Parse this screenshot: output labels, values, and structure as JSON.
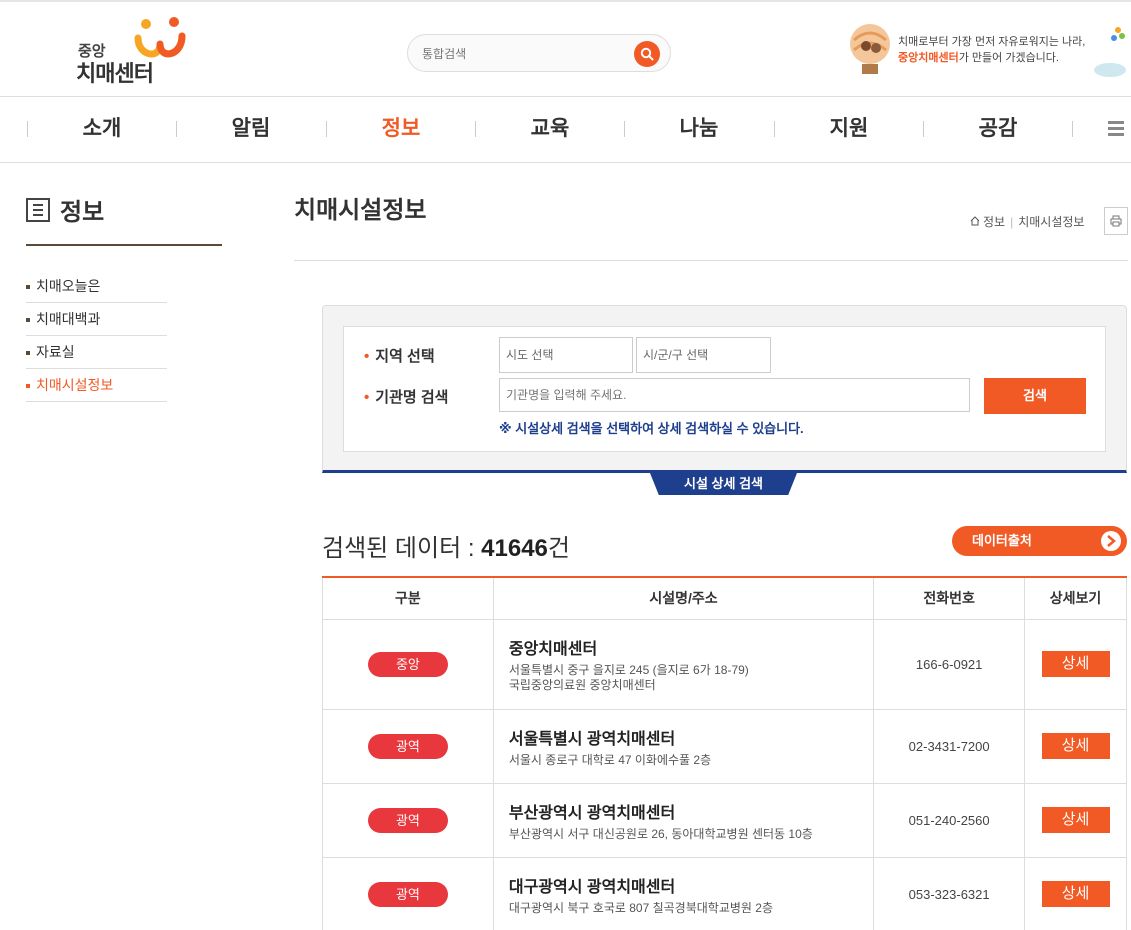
{
  "header": {
    "logo_small": "중앙",
    "logo_big": "치매센터",
    "search_placeholder": "통합검색",
    "slogan_line1": "치매로부터 가장 먼저 자유로워지는 나라,",
    "slogan_org": "중앙치매센터",
    "slogan_line2_rest": "가 만들어 가겠습니다."
  },
  "gnb": {
    "items": [
      {
        "label": "소개"
      },
      {
        "label": "알림"
      },
      {
        "label": "정보"
      },
      {
        "label": "교육"
      },
      {
        "label": "나눔"
      },
      {
        "label": "지원"
      },
      {
        "label": "공감"
      }
    ],
    "active_index": 2
  },
  "side": {
    "title": "정보",
    "items": [
      {
        "label": "치매오늘은"
      },
      {
        "label": "치매대백과"
      },
      {
        "label": "자료실"
      },
      {
        "label": "치매시설정보"
      }
    ],
    "active_index": 3
  },
  "page": {
    "title": "치매시설정보",
    "breadcrumb": [
      "정보",
      "치매시설정보"
    ]
  },
  "search": {
    "region_label": "지역 선택",
    "sido_placeholder": "시도 선택",
    "sigungu_placeholder": "시/군/구 선택",
    "name_label": "기관명 검색",
    "name_placeholder": "기관명을 입력해 주세요.",
    "submit_label": "검색",
    "hint": "※ 시설상세 검색을 선택하여 상세 검색하실 수 있습니다.",
    "detail_tab": "시설 상세 검색"
  },
  "result": {
    "prefix": "검색된 데이터 : ",
    "count": "41646",
    "suffix": "건",
    "export_label": "데이터출처"
  },
  "table": {
    "headers": [
      "구분",
      "시설명/주소",
      "전화번호",
      "상세보기"
    ],
    "rows": [
      {
        "type": "중앙",
        "name": "중앙치매센터",
        "addr1": "서울특별시 중구 을지로 245 (을지로 6가 18-79)",
        "addr2": "국립중앙의료원 중앙치매센터",
        "phone": "166-6-0921",
        "detail": "상세"
      },
      {
        "type": "광역",
        "name": "서울특별시 광역치매센터",
        "addr1": "서울시 종로구 대학로 47 이화에수풀 2층",
        "addr2": "",
        "phone": "02-3431-7200",
        "detail": "상세"
      },
      {
        "type": "광역",
        "name": "부산광역시 광역치매센터",
        "addr1": "부산광역시 서구 대신공원로 26, 동아대학교병원 센터동 10층",
        "addr2": "",
        "phone": "051-240-2560",
        "detail": "상세"
      },
      {
        "type": "광역",
        "name": "대구광역시 광역치매센터",
        "addr1": "대구광역시 북구 호국로 807 칠곡경북대학교병원 2층",
        "addr2": "",
        "phone": "053-323-6321",
        "detail": "상세"
      }
    ]
  },
  "colors": {
    "accent": "#f15a24",
    "navy": "#1e3f8e",
    "badge": "#e8383d"
  }
}
